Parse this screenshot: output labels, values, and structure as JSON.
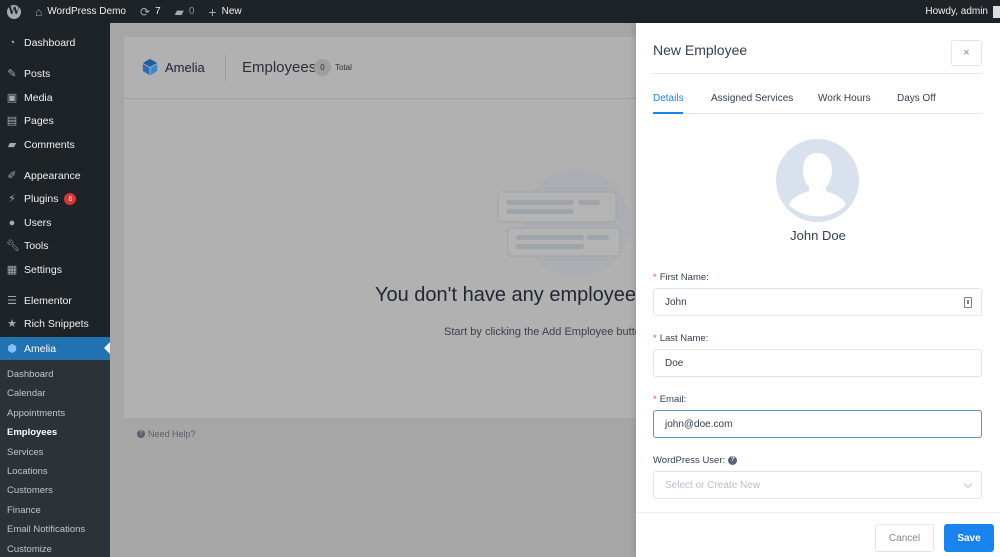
{
  "adminbar": {
    "site_name": "WordPress Demo",
    "updates_count": "7",
    "comments_count": "0",
    "new_label": "New",
    "greeting": "Howdy, admin"
  },
  "sidebar": {
    "items": [
      {
        "label": "Dashboard",
        "icon": "dashboard-icon"
      },
      {
        "label": "Posts",
        "icon": "pin-icon"
      },
      {
        "label": "Media",
        "icon": "media-icon"
      },
      {
        "label": "Pages",
        "icon": "pages-icon"
      },
      {
        "label": "Comments",
        "icon": "comment-icon"
      },
      {
        "label": "Appearance",
        "icon": "brush-icon"
      },
      {
        "label": "Plugins",
        "icon": "plug-icon",
        "badge": "6"
      },
      {
        "label": "Users",
        "icon": "user-icon"
      },
      {
        "label": "Tools",
        "icon": "wrench-icon"
      },
      {
        "label": "Settings",
        "icon": "settings-icon"
      },
      {
        "label": "Elementor",
        "icon": "elementor-icon"
      },
      {
        "label": "Rich Snippets",
        "icon": "star-icon"
      },
      {
        "label": "Amelia",
        "icon": "amelia-icon",
        "active": true
      }
    ],
    "submenu": [
      {
        "label": "Dashboard"
      },
      {
        "label": "Calendar"
      },
      {
        "label": "Appointments"
      },
      {
        "label": "Employees",
        "current": true
      },
      {
        "label": "Services"
      },
      {
        "label": "Locations"
      },
      {
        "label": "Customers"
      },
      {
        "label": "Finance"
      },
      {
        "label": "Email Notifications"
      },
      {
        "label": "Customize"
      }
    ]
  },
  "page": {
    "brand": "Amelia",
    "title": "Employees",
    "count": "0",
    "count_suffix": "Total",
    "empty_title": "You don't have any employees here yet...",
    "empty_subtitle": "Start by clicking the Add Employee button",
    "help_link": "Need Help?"
  },
  "drawer": {
    "title": "New Employee",
    "close_label": "×",
    "tabs": [
      {
        "label": "Details",
        "active": true
      },
      {
        "label": "Assigned Services"
      },
      {
        "label": "Work Hours"
      },
      {
        "label": "Days Off"
      }
    ],
    "employee_name": "John Doe",
    "fields": {
      "first_name": {
        "label": "First Name:",
        "value": "John",
        "required": true
      },
      "last_name": {
        "label": "Last Name:",
        "value": "Doe",
        "required": true
      },
      "email": {
        "label": "Email:",
        "value": "john@doe.com",
        "required": true
      },
      "wp_user": {
        "label": "WordPress User:",
        "placeholder": "Select or Create New",
        "value": ""
      }
    },
    "required_mark": "*",
    "cancel_label": "Cancel",
    "save_label": "Save"
  },
  "colors": {
    "accent": "#1a84ee",
    "wp_admin_dark": "#1d2327",
    "wp_active": "#2271b1",
    "required": "#f04e4e",
    "badge": "#d63638"
  }
}
